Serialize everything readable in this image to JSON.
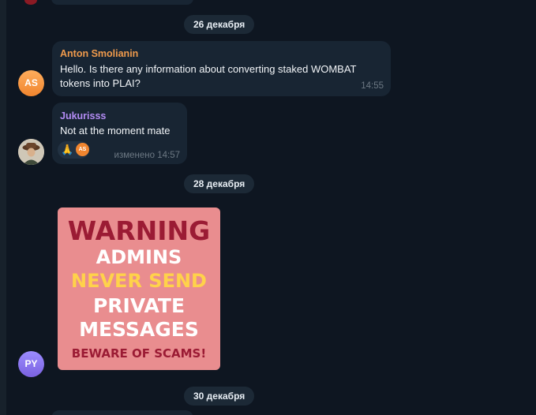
{
  "dates": [
    "26 декабря",
    "28 декабря",
    "30 декабря"
  ],
  "messages": [
    {
      "avatar_initials": "AS",
      "avatar_color": "#f0852f",
      "sender": "Anton Smolianin",
      "sender_color": "#ef9a4c",
      "lines": [
        "Hello. Is there any information about converting staked WOMBAT",
        "tokens into PLAI?"
      ],
      "time": "14:55"
    },
    {
      "avatar_icon": "user-photo-avatar",
      "sender": "Jukurisss",
      "sender_color": "#b48cf5",
      "text": "Not at the moment mate",
      "reaction": {
        "emoji": "🙏",
        "reactor_initials": "AS"
      },
      "meta": "изменено 14:57"
    },
    {
      "avatar_initials": "PY",
      "avatar_color": "#8a73f0",
      "image": {
        "background": "#e98d8f",
        "lines": [
          "WARNING",
          "ADMINS",
          "NEVER SEND",
          "PRIVATE",
          "MESSAGES",
          "BEWARE OF SCAMS!"
        ],
        "colors": [
          "#9b1b34",
          "#ffffff",
          "#ffd24a",
          "#ffffff",
          "#ffffff",
          "#9b1b34"
        ]
      }
    }
  ]
}
